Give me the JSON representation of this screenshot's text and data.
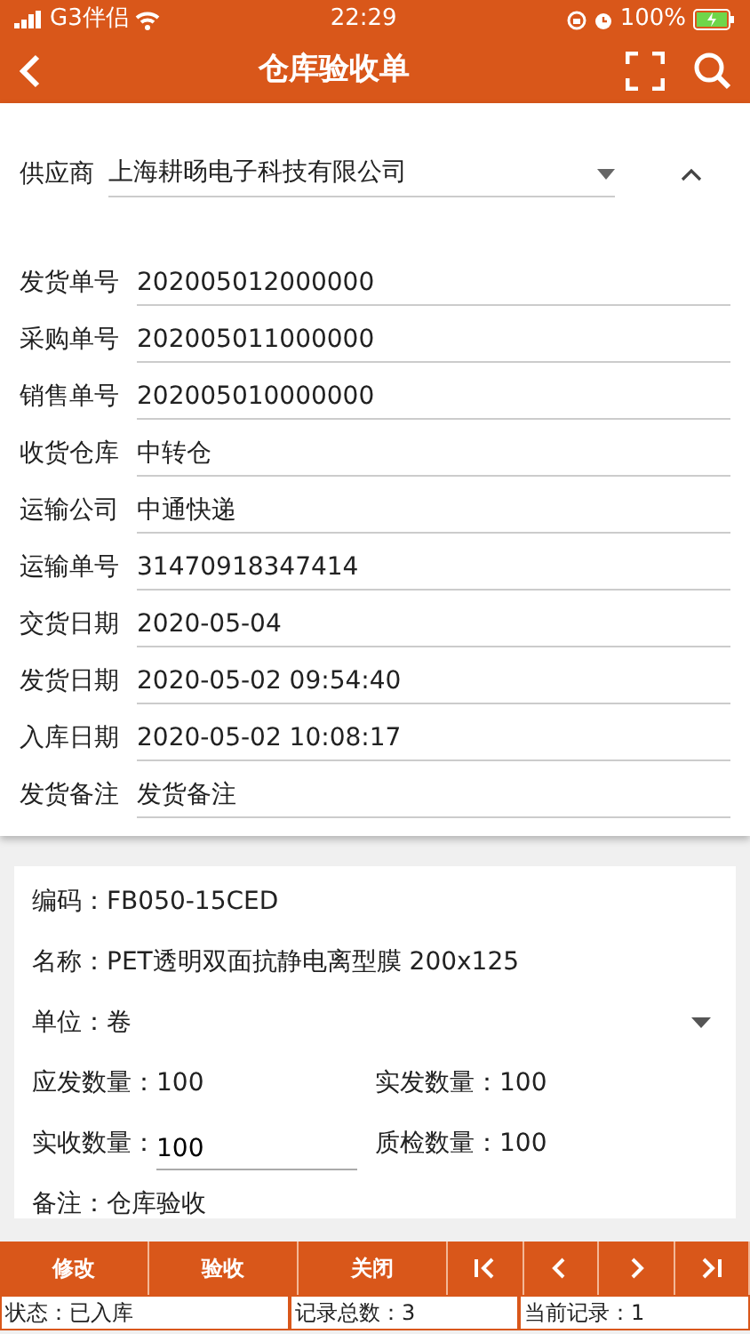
{
  "status_bar": {
    "carrier": "G3伴侣",
    "time": "22:29",
    "battery": "100%"
  },
  "app_bar": {
    "title": "仓库验收单"
  },
  "header": {
    "expanded": true,
    "supplier": {
      "label": "供应商",
      "value": "上海耕旸电子科技有限公司"
    },
    "fields": [
      {
        "label": "发货单号",
        "value": "202005012000000"
      },
      {
        "label": "采购单号",
        "value": "202005011000000"
      },
      {
        "label": "销售单号",
        "value": "202005010000000"
      },
      {
        "label": "收货仓库",
        "value": "中转仓"
      },
      {
        "label": "运输公司",
        "value": "中通快递"
      },
      {
        "label": "运输单号",
        "value": "31470918347414"
      },
      {
        "label": "交货日期",
        "value": "2020-05-04"
      },
      {
        "label": "发货日期",
        "value": "2020-05-02 09:54:40"
      },
      {
        "label": "入库日期",
        "value": "2020-05-02 10:08:17"
      },
      {
        "label": "发货备注",
        "value": "发货备注"
      }
    ]
  },
  "item": {
    "lines": [
      {
        "kind": "text",
        "cells": [
          {
            "kind": "text",
            "label": "编码：",
            "value": "FB050-15CED"
          }
        ]
      },
      {
        "kind": "text",
        "cells": [
          {
            "kind": "text",
            "label": "名称：",
            "value": "PET透明双面抗静电离型膜 200x125"
          }
        ]
      },
      {
        "kind": "select",
        "cells": [
          {
            "kind": "text",
            "label": "单位：",
            "value": "卷"
          }
        ]
      },
      {
        "kind": "pair",
        "cells": [
          {
            "kind": "text",
            "label": "应发数量：",
            "value": "100"
          },
          {
            "kind": "text",
            "label": "实发数量：",
            "value": "100"
          }
        ]
      },
      {
        "kind": "pair",
        "cells": [
          {
            "kind": "input",
            "label": "实收数量：",
            "value": "100"
          },
          {
            "kind": "text",
            "label": "质检数量：",
            "value": "100"
          }
        ]
      },
      {
        "kind": "text",
        "cells": [
          {
            "kind": "text",
            "label": "备注：",
            "value": "仓库验收"
          }
        ]
      }
    ]
  },
  "toolbar": {
    "actions": [
      "修改",
      "验收",
      "关闭"
    ],
    "nav": [
      {
        "kind": "first"
      },
      {
        "kind": "prev"
      },
      {
        "kind": "next"
      },
      {
        "kind": "last"
      }
    ]
  },
  "footer": [
    "状态：已入库",
    "记录总数：3",
    "当前记录：1"
  ]
}
